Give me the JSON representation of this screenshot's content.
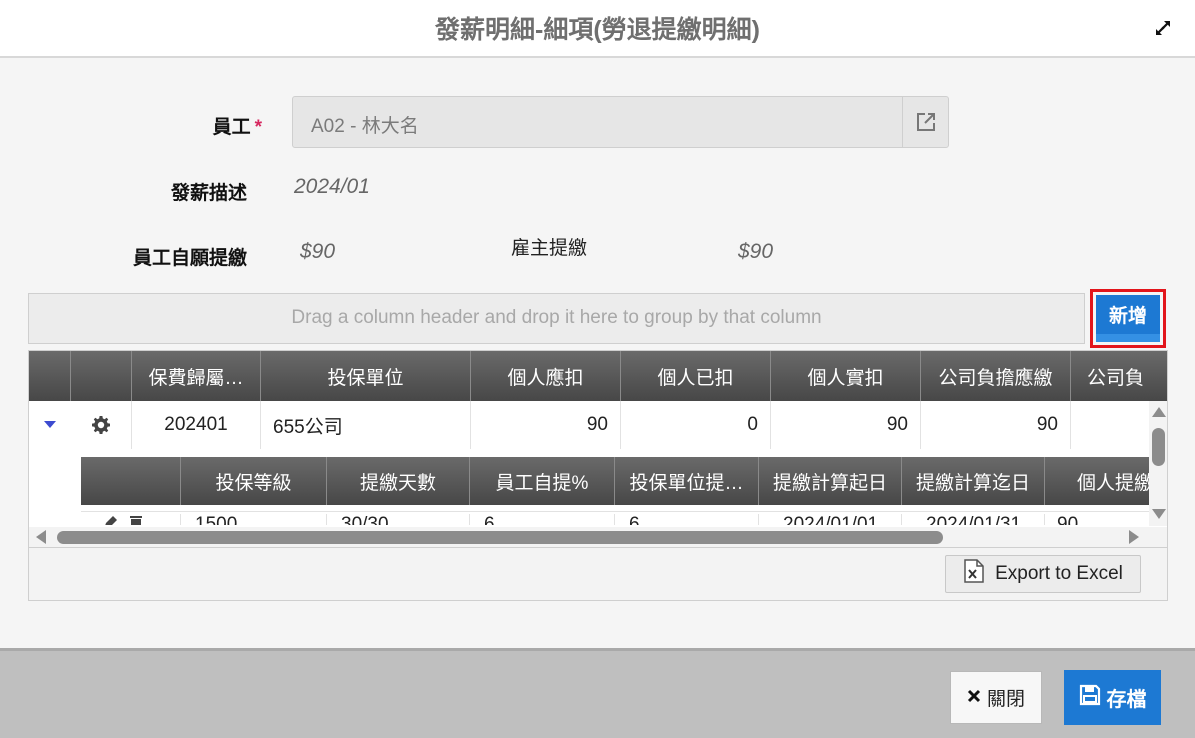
{
  "header": {
    "title": "發薪明細-細項(勞退提繳明細)"
  },
  "form": {
    "employee_label": "員工",
    "required_mark": "*",
    "employee_value": "A02 - 林大名",
    "desc_label": "發薪描述",
    "desc_value": "2024/01",
    "voluntary_label": "員工自願提繳",
    "voluntary_value": "$90",
    "employer_label": "雇主提繳",
    "employer_value": "$90"
  },
  "grid": {
    "group_hint": "Drag a column header and drop it here to group by that column",
    "add_label": "新增",
    "columns": [
      "保費歸屬…",
      "投保單位",
      "個人應扣",
      "個人已扣",
      "個人實扣",
      "公司負擔應繳",
      "公司負"
    ],
    "row": [
      "202401",
      "655公司",
      "90",
      "0",
      "90",
      "90",
      ""
    ],
    "sub_columns": [
      "投保等級",
      "提繳天數",
      "員工自提%",
      "投保單位提…",
      "提繳計算起日",
      "提繳計算迄日",
      "個人提繳"
    ],
    "sub_row": [
      "1500",
      "30/30",
      "6",
      "6",
      "2024/01/01",
      "2024/01/31",
      "90"
    ],
    "export_label": "Export to Excel"
  },
  "footer": {
    "close_label": "關閉",
    "save_label": "存檔"
  },
  "colors": {
    "accent": "#1d79d3",
    "required": "#d6275f",
    "highlight_border": "#e2151b"
  },
  "icons": [
    "expand-icon",
    "external-link-icon",
    "expand-row-icon",
    "gear-icon",
    "edit-icon",
    "delete-icon",
    "excel-icon",
    "close-x-icon",
    "save-disk-icon"
  ]
}
